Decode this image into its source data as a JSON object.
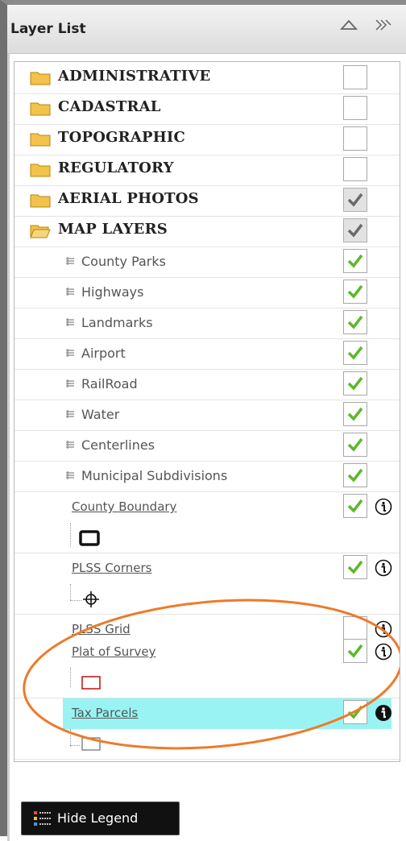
{
  "panel": {
    "title": "Layer List"
  },
  "groups": [
    {
      "label": "ADMINISTRATIVE",
      "checked": false,
      "open": false
    },
    {
      "label": "CADASTRAL",
      "checked": false,
      "open": false
    },
    {
      "label": "TOPOGRAPHIC",
      "checked": false,
      "open": false
    },
    {
      "label": "REGULATORY",
      "checked": false,
      "open": false
    },
    {
      "label": "AERIAL PHOTOS",
      "checked": true,
      "open": false
    },
    {
      "label": "MAP LAYERS",
      "checked": true,
      "open": true
    }
  ],
  "sublayers": [
    {
      "label": "County Parks",
      "checked": true
    },
    {
      "label": "Highways",
      "checked": true
    },
    {
      "label": "Landmarks",
      "checked": true
    },
    {
      "label": "Airport",
      "checked": true
    },
    {
      "label": "RailRoad",
      "checked": true
    },
    {
      "label": "Water",
      "checked": true
    },
    {
      "label": "Centerlines",
      "checked": true
    },
    {
      "label": "Municipal Subdivisions",
      "checked": true
    }
  ],
  "layers": [
    {
      "label": "County Boundary",
      "checked": true,
      "legend": "black-rectangle-symbol"
    },
    {
      "label": "PLSS Corners",
      "checked": true,
      "legend": "crosshair-symbol"
    },
    {
      "label": "PLSS Grid",
      "checked": false,
      "legend": null
    },
    {
      "label": "Plat of Survey",
      "checked": true,
      "legend": "red-rectangle-symbol"
    },
    {
      "label": "Tax Parcels",
      "checked": true,
      "legend": "gray-rectangle-symbol",
      "selected": true
    }
  ],
  "footer": {
    "hide_legend_label": "Hide Legend"
  },
  "colors": {
    "check_green": "#5cb82c",
    "check_gray": "#6a6a6a",
    "highlight": "#99f3f3",
    "annotation_circle": "#ee7a2a",
    "plat_symbol": "#c02020"
  },
  "icons": [
    "folder-icon",
    "folder-open-icon",
    "layer-stack-icon",
    "info-icon",
    "collapse-icon",
    "expand-icon",
    "legend-icon"
  ]
}
